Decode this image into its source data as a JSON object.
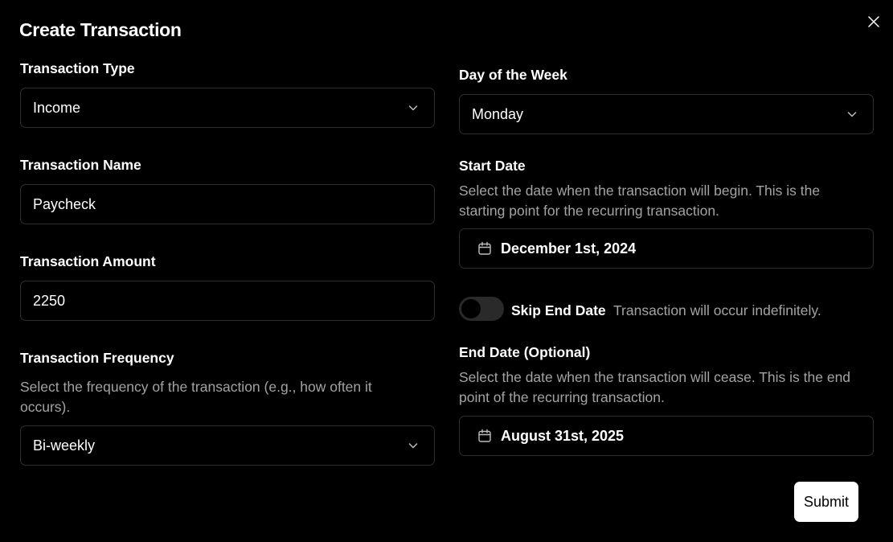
{
  "dialog": {
    "title": "Create Transaction",
    "close_icon": "close-icon"
  },
  "form": {
    "transaction_type": {
      "label": "Transaction Type",
      "value": "Income",
      "icon": "chevron-down-icon"
    },
    "transaction_name": {
      "label": "Transaction Name",
      "value": "Paycheck"
    },
    "transaction_amount": {
      "label": "Transaction Amount",
      "value": "2250"
    },
    "transaction_frequency": {
      "label": "Transaction Frequency",
      "description": "Select the frequency of the transaction (e.g., how often it occurs).",
      "value": "Bi-weekly",
      "icon": "chevron-down-icon"
    },
    "day_of_week": {
      "label": "Day of the Week",
      "value": "Monday",
      "icon": "chevron-down-icon"
    },
    "start_date": {
      "label": "Start Date",
      "description": "Select the date when the transaction will begin. This is the starting point for the recurring transaction.",
      "value": "December 1st, 2024",
      "icon": "calendar-icon"
    },
    "skip_end_date": {
      "label": "Skip End Date",
      "description": "Transaction will occur indefinitely.",
      "checked": false
    },
    "end_date": {
      "label": "End Date (Optional)",
      "description": "Select the date when the transaction will cease. This is the end point of the recurring transaction.",
      "value": "August 31st, 2025",
      "icon": "calendar-icon"
    },
    "submit_label": "Submit"
  },
  "colors": {
    "background": "#000000",
    "text": "#ffffff",
    "muted_text": "#a3a3a3",
    "border": "#2e2e2e",
    "button_bg": "#ffffff",
    "button_text": "#000000"
  }
}
